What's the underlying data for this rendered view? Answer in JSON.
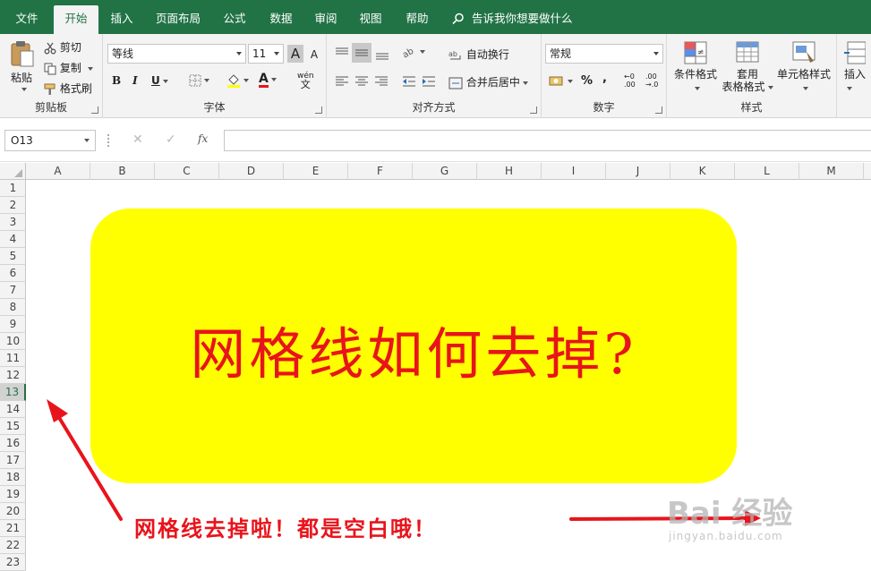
{
  "ribbon_tabs": [
    "文件",
    "开始",
    "插入",
    "页面布局",
    "公式",
    "数据",
    "审阅",
    "视图",
    "帮助"
  ],
  "active_tab": "开始",
  "tell_me": "告诉我你想要做什么",
  "clipboard": {
    "paste": "粘贴",
    "cut": "剪切",
    "copy": "复制",
    "format_painter": "格式刷",
    "label": "剪贴板"
  },
  "font": {
    "name": "等线",
    "size": "11",
    "grow": "A",
    "shrink": "A",
    "bold": "B",
    "italic": "I",
    "underline": "U",
    "font_color": "A",
    "phonetic_top": "wén",
    "phonetic_bottom": "文",
    "label": "字体"
  },
  "alignment": {
    "wrap": "自动换行",
    "merge": "合并后居中",
    "label": "对齐方式"
  },
  "number": {
    "format": "常规",
    "percent": "%",
    "comma": ",",
    "inc_dec_top": "←0",
    "inc_dec_bottom": ".00",
    "dec_dec_top": ".00",
    "dec_dec_bottom": "→.0",
    "label": "数字"
  },
  "styles": {
    "conditional": "条件格式",
    "table_top": "套用",
    "table_bottom": "表格格式",
    "cell_styles": "单元格样式",
    "label": "样式"
  },
  "cells": {
    "insert": "插入"
  },
  "formula_bar": {
    "name_box": "O13",
    "cancel": "✕",
    "enter": "✓",
    "fx": "fx",
    "value": ""
  },
  "columns": [
    "A",
    "B",
    "C",
    "D",
    "E",
    "F",
    "G",
    "H",
    "I",
    "J",
    "K",
    "L",
    "M"
  ],
  "rows": [
    "1",
    "2",
    "3",
    "4",
    "5",
    "6",
    "7",
    "8",
    "9",
    "10",
    "11",
    "12",
    "13",
    "14",
    "15",
    "16",
    "17",
    "18",
    "19",
    "20",
    "21",
    "22",
    "23"
  ],
  "selected_row": "13",
  "banner_text": "网格线如何去掉?",
  "caption_text": "网格线去掉啦！都是空白哦！",
  "watermark": {
    "main": "Bai 经验",
    "sub": "jingyan.baidu.com"
  },
  "colors": {
    "excel_green": "#217346",
    "banner_yellow": "#ffff00",
    "text_red": "#e8141b"
  }
}
